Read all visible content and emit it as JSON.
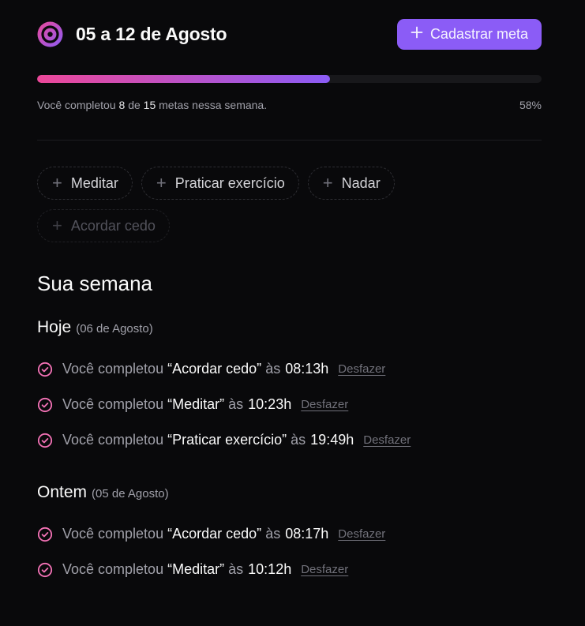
{
  "header": {
    "title": "05 a 12 de Agosto",
    "logo_icon": "target-ring-icon",
    "add_button_label": "Cadastrar meta",
    "add_button_icon": "plus-icon"
  },
  "progress": {
    "percent_value": 0.58,
    "text_prefix": "Você completou",
    "completed": "8",
    "text_middle": "de",
    "total": "15",
    "text_suffix": "metas nessa semana.",
    "percent_label": "58%",
    "gradient_from": "#ec4899",
    "gradient_to": "#8b5cf6"
  },
  "chips": [
    {
      "label": "Meditar",
      "disabled": false
    },
    {
      "label": "Praticar exercício",
      "disabled": false
    },
    {
      "label": "Nadar",
      "disabled": false
    },
    {
      "label": "Acordar cedo",
      "disabled": true
    }
  ],
  "week": {
    "title": "Sua semana",
    "days": [
      {
        "name": "Hoje",
        "date": "(06 de Agosto)",
        "entries": [
          {
            "prefix": "Você completou",
            "goal": "“Acordar cedo”",
            "at": "às",
            "time": "08:13h",
            "undo": "Desfazer"
          },
          {
            "prefix": "Você completou",
            "goal": "“Meditar”",
            "at": "às",
            "time": "10:23h",
            "undo": "Desfazer"
          },
          {
            "prefix": "Você completou",
            "goal": "“Praticar exercício”",
            "at": "às",
            "time": "19:49h",
            "undo": "Desfazer"
          }
        ]
      },
      {
        "name": "Ontem",
        "date": "(05 de Agosto)",
        "entries": [
          {
            "prefix": "Você completou",
            "goal": "“Acordar cedo”",
            "at": "às",
            "time": "08:17h",
            "undo": "Desfazer"
          },
          {
            "prefix": "Você completou",
            "goal": "“Meditar”",
            "at": "às",
            "time": "10:12h",
            "undo": "Desfazer"
          }
        ]
      }
    ]
  },
  "colors": {
    "background": "#09090b",
    "accent": "#8b5cf6",
    "check": "#f472b6"
  }
}
